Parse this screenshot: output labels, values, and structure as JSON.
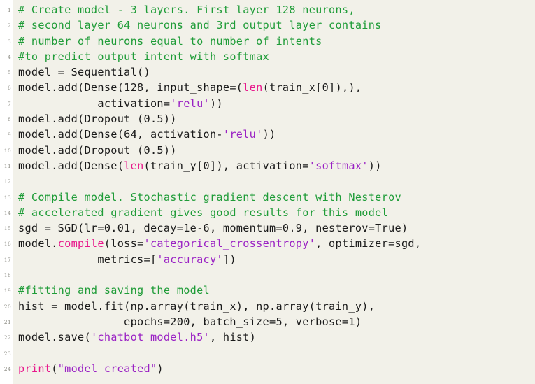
{
  "editor": {
    "language": "Python",
    "background_color": "#f2f1e9",
    "gutter_color": "#ffffff",
    "total_lines": 24,
    "colors": {
      "comment": "#1f9c38",
      "builtin": "#e8188b",
      "string": "#9a21c4",
      "plain": "#1a1a1a",
      "lineno": "#8a8a82"
    }
  },
  "lines": [
    {
      "number": "1",
      "tokens": [
        {
          "text": "# Create model - 3 layers. First layer 128 neurons,",
          "kind": "comment"
        }
      ]
    },
    {
      "number": "2",
      "tokens": [
        {
          "text": "# second layer 64 neurons and 3rd output layer contains",
          "kind": "comment"
        }
      ]
    },
    {
      "number": "3",
      "tokens": [
        {
          "text": "# number of neurons equal to number of intents",
          "kind": "comment"
        }
      ]
    },
    {
      "number": "4",
      "tokens": [
        {
          "text": "#to predict output intent with softmax",
          "kind": "comment"
        }
      ]
    },
    {
      "number": "5",
      "tokens": [
        {
          "text": "model = Sequential()",
          "kind": "plain"
        }
      ]
    },
    {
      "number": "6",
      "tokens": [
        {
          "text": "model.add(Dense(128, input_shape=(",
          "kind": "plain"
        },
        {
          "text": "len",
          "kind": "builtin"
        },
        {
          "text": "(train_x[0]),),",
          "kind": "plain"
        }
      ]
    },
    {
      "number": "7",
      "tokens": [
        {
          "text": "            activation=",
          "kind": "plain"
        },
        {
          "text": "'relu'",
          "kind": "string"
        },
        {
          "text": "))",
          "kind": "plain"
        }
      ]
    },
    {
      "number": "8",
      "tokens": [
        {
          "text": "model.add(Dropout (0.5))",
          "kind": "plain"
        }
      ]
    },
    {
      "number": "9",
      "tokens": [
        {
          "text": "model.add(Dense(64, activation-",
          "kind": "plain"
        },
        {
          "text": "'relu'",
          "kind": "string"
        },
        {
          "text": "))",
          "kind": "plain"
        }
      ]
    },
    {
      "number": "10",
      "tokens": [
        {
          "text": "model.add(Dropout (0.5))",
          "kind": "plain"
        }
      ]
    },
    {
      "number": "11",
      "tokens": [
        {
          "text": "model.add(Dense(",
          "kind": "plain"
        },
        {
          "text": "len",
          "kind": "builtin"
        },
        {
          "text": "(train_y[0]), activation=",
          "kind": "plain"
        },
        {
          "text": "'softmax'",
          "kind": "string"
        },
        {
          "text": "))",
          "kind": "plain"
        }
      ]
    },
    {
      "number": "12",
      "tokens": [
        {
          "text": "",
          "kind": "plain"
        }
      ]
    },
    {
      "number": "13",
      "tokens": [
        {
          "text": "# Compile model. Stochastic gradient descent with Nesterov",
          "kind": "comment"
        }
      ]
    },
    {
      "number": "14",
      "tokens": [
        {
          "text": "# accelerated gradient gives good results for this model",
          "kind": "comment"
        }
      ]
    },
    {
      "number": "15",
      "tokens": [
        {
          "text": "sgd = SGD(lr=0.01, decay=1e-6, momentum=0.9, nesterov=True)",
          "kind": "plain"
        }
      ]
    },
    {
      "number": "16",
      "tokens": [
        {
          "text": "model.",
          "kind": "plain"
        },
        {
          "text": "compile",
          "kind": "builtin"
        },
        {
          "text": "(loss=",
          "kind": "plain"
        },
        {
          "text": "'categorical_crossentropy'",
          "kind": "string"
        },
        {
          "text": ", optimizer=sgd,",
          "kind": "plain"
        }
      ]
    },
    {
      "number": "17",
      "tokens": [
        {
          "text": "            metrics=[",
          "kind": "plain"
        },
        {
          "text": "'accuracy'",
          "kind": "string"
        },
        {
          "text": "])",
          "kind": "plain"
        }
      ]
    },
    {
      "number": "18",
      "tokens": [
        {
          "text": "",
          "kind": "plain"
        }
      ]
    },
    {
      "number": "19",
      "tokens": [
        {
          "text": "#fitting and saving the model",
          "kind": "comment"
        }
      ]
    },
    {
      "number": "20",
      "tokens": [
        {
          "text": "hist = model.fit(np.array(train_x), np.array(train_y),",
          "kind": "plain"
        }
      ]
    },
    {
      "number": "21",
      "tokens": [
        {
          "text": "                epochs=200, batch_size=5, verbose=1)",
          "kind": "plain"
        }
      ]
    },
    {
      "number": "22",
      "tokens": [
        {
          "text": "model.save(",
          "kind": "plain"
        },
        {
          "text": "'chatbot_model.h5'",
          "kind": "string"
        },
        {
          "text": ", hist)",
          "kind": "plain"
        }
      ]
    },
    {
      "number": "23",
      "tokens": [
        {
          "text": "",
          "kind": "plain"
        }
      ]
    },
    {
      "number": "24",
      "tokens": [
        {
          "text": "print",
          "kind": "builtin"
        },
        {
          "text": "(",
          "kind": "plain"
        },
        {
          "text": "\"model created\"",
          "kind": "string"
        },
        {
          "text": ")",
          "kind": "plain"
        }
      ]
    }
  ]
}
